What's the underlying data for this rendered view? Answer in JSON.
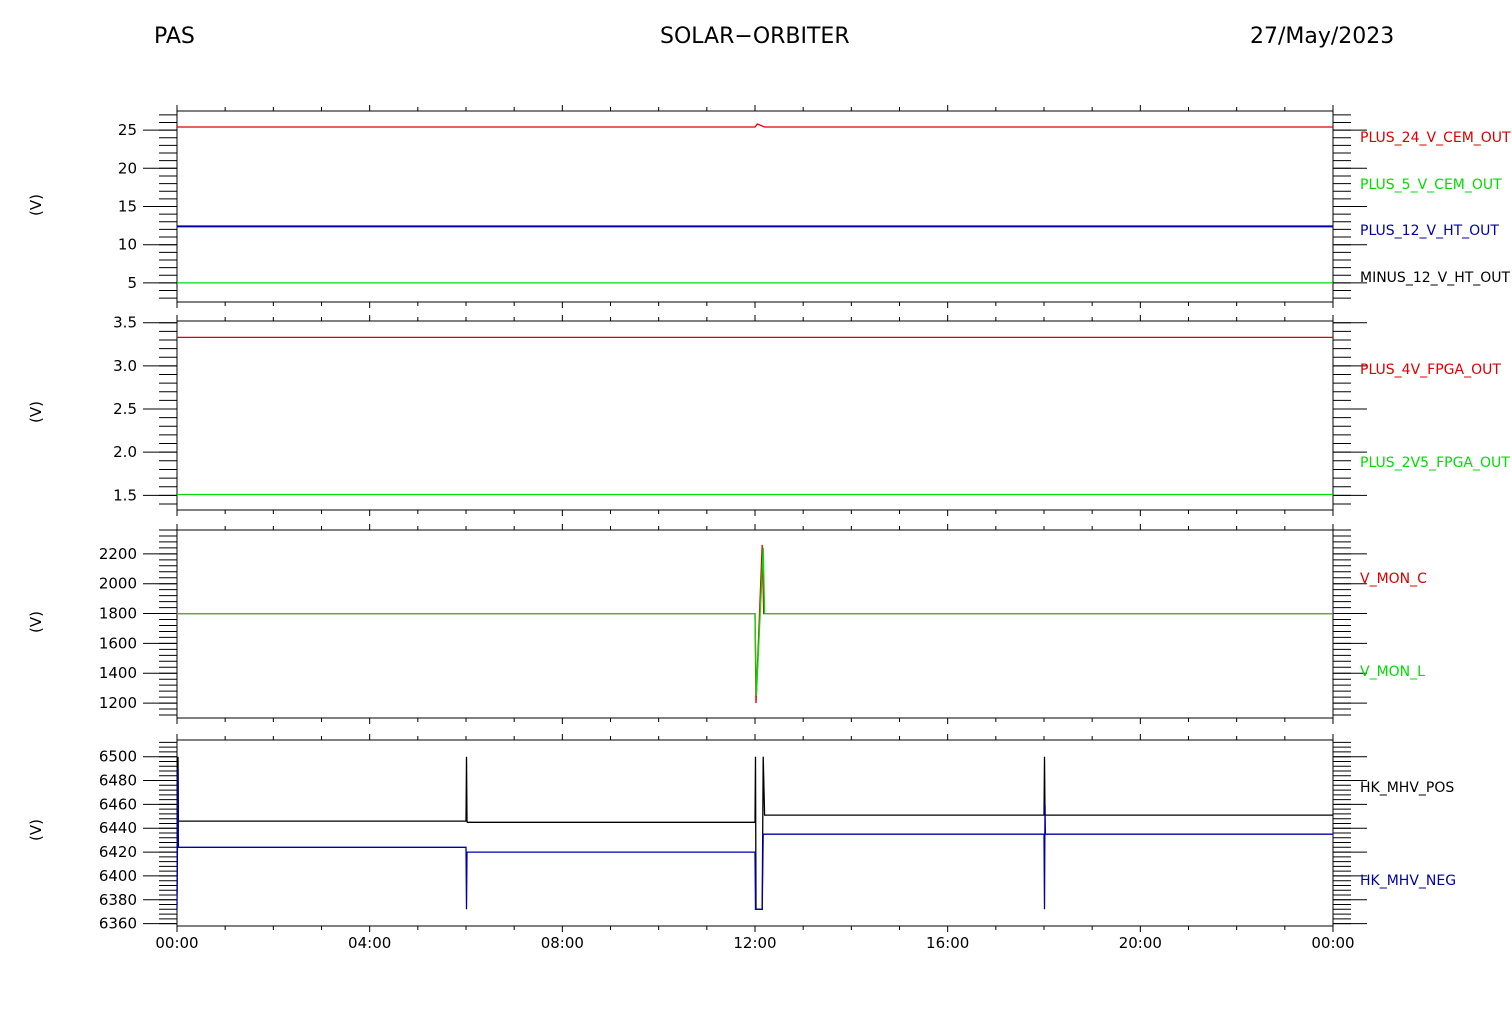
{
  "header": {
    "left": "PAS",
    "center": "SOLAR−ORBITER",
    "right": "27/May/2023"
  },
  "colors": {
    "red": "#dd0000",
    "green": "#00dd00",
    "blue": "#0000aa",
    "black": "#000000"
  },
  "chart_data": [
    {
      "type": "line",
      "ylabel": "(V)",
      "ylim": [
        2.5,
        27.5
      ],
      "yticks": [
        5,
        10,
        15,
        20,
        25
      ],
      "x_tick_labels": [
        "00:00",
        "04:00",
        "08:00",
        "12:00",
        "16:00",
        "20:00",
        "00:00"
      ],
      "series": [
        {
          "name": "PLUS_24_V_CEM_OUT",
          "color": "red",
          "x": [
            0,
            12.0,
            12.05,
            12.2,
            24
          ],
          "y": [
            25.4,
            25.4,
            25.8,
            25.4,
            25.4
          ]
        },
        {
          "name": "PLUS_5_V_CEM_OUT",
          "color": "green",
          "x": [
            0,
            24
          ],
          "y": [
            5.0,
            5.0
          ]
        },
        {
          "name": "PLUS_12_V_HT_OUT",
          "color": "blue",
          "x": [
            0,
            24
          ],
          "y": [
            12.4,
            12.4
          ]
        },
        {
          "name": "MINUS_12_V_HT_OUT",
          "color": "black",
          "x": [],
          "y": []
        }
      ]
    },
    {
      "type": "line",
      "ylabel": "(V)",
      "ylim": [
        1.33,
        3.52
      ],
      "yticks": [
        1.5,
        2.0,
        2.5,
        3.0,
        3.5
      ],
      "ytick_labels": [
        "1.5",
        "2.0",
        "2.5",
        "3.0",
        "3.5"
      ],
      "x_tick_labels": [
        "00:00",
        "04:00",
        "08:00",
        "12:00",
        "16:00",
        "20:00",
        "00:00"
      ],
      "series": [
        {
          "name": "PLUS_4V_FPGA_OUT",
          "color": "red",
          "x": [
            0,
            24
          ],
          "y": [
            3.33,
            3.33
          ]
        },
        {
          "name": "PLUS_2V5_FPGA_OUT",
          "color": "green",
          "x": [
            0,
            24
          ],
          "y": [
            1.51,
            1.51
          ]
        }
      ]
    },
    {
      "type": "line",
      "ylabel": "(V)",
      "ylim": [
        1100,
        2360
      ],
      "yticks": [
        1200,
        1400,
        1600,
        1800,
        2000,
        2200
      ],
      "x_tick_labels": [
        "00:00",
        "04:00",
        "08:00",
        "12:00",
        "16:00",
        "20:00",
        "00:00"
      ],
      "series": [
        {
          "name": "V_MON_C",
          "color": "red",
          "x": [
            0,
            12.0,
            12.02,
            12.15,
            12.18,
            24
          ],
          "y": [
            1800,
            1800,
            1200,
            2260,
            1800,
            1800
          ]
        },
        {
          "name": "V_MON_L",
          "color": "green",
          "x": [
            0,
            12.0,
            12.03,
            12.17,
            12.2,
            24
          ],
          "y": [
            1800,
            1800,
            1250,
            2240,
            1800,
            1800
          ]
        }
      ]
    },
    {
      "type": "line",
      "ylabel": "(V)",
      "ylim": [
        6358,
        6514
      ],
      "yticks": [
        6360,
        6380,
        6400,
        6420,
        6440,
        6460,
        6480,
        6500
      ],
      "x_tick_labels": [
        "00:00",
        "04:00",
        "08:00",
        "12:00",
        "16:00",
        "20:00",
        "00:00"
      ],
      "series": [
        {
          "name": "HK_MHV_POS",
          "color": "black",
          "x": [
            0,
            0.02,
            0.03,
            0.04,
            0.05,
            6.0,
            6.01,
            6.02,
            6.03,
            6.05,
            12.0,
            12.01,
            12.02,
            12.15,
            12.17,
            12.2,
            18.0,
            18.01,
            18.02,
            18.03,
            24
          ],
          "y": [
            6385,
            6500,
            6446,
            6446,
            6446,
            6446,
            6500,
            6446,
            6445,
            6445,
            6445,
            6500,
            6372,
            6372,
            6500,
            6451,
            6451,
            6500,
            6451,
            6451,
            6451
          ]
        },
        {
          "name": "HK_MHV_NEG",
          "color": "blue",
          "x": [
            0,
            0.02,
            0.03,
            0.05,
            6.0,
            6.01,
            6.02,
            6.05,
            12.0,
            12.01,
            12.02,
            12.15,
            12.17,
            12.2,
            18.0,
            18.01,
            18.02,
            18.03,
            24
          ],
          "y": [
            6372,
            6490,
            6424,
            6424,
            6424,
            6372,
            6420,
            6420,
            6420,
            6372,
            6372,
            6372,
            6435,
            6435,
            6435,
            6372,
            6460,
            6435,
            6435
          ]
        }
      ]
    }
  ]
}
